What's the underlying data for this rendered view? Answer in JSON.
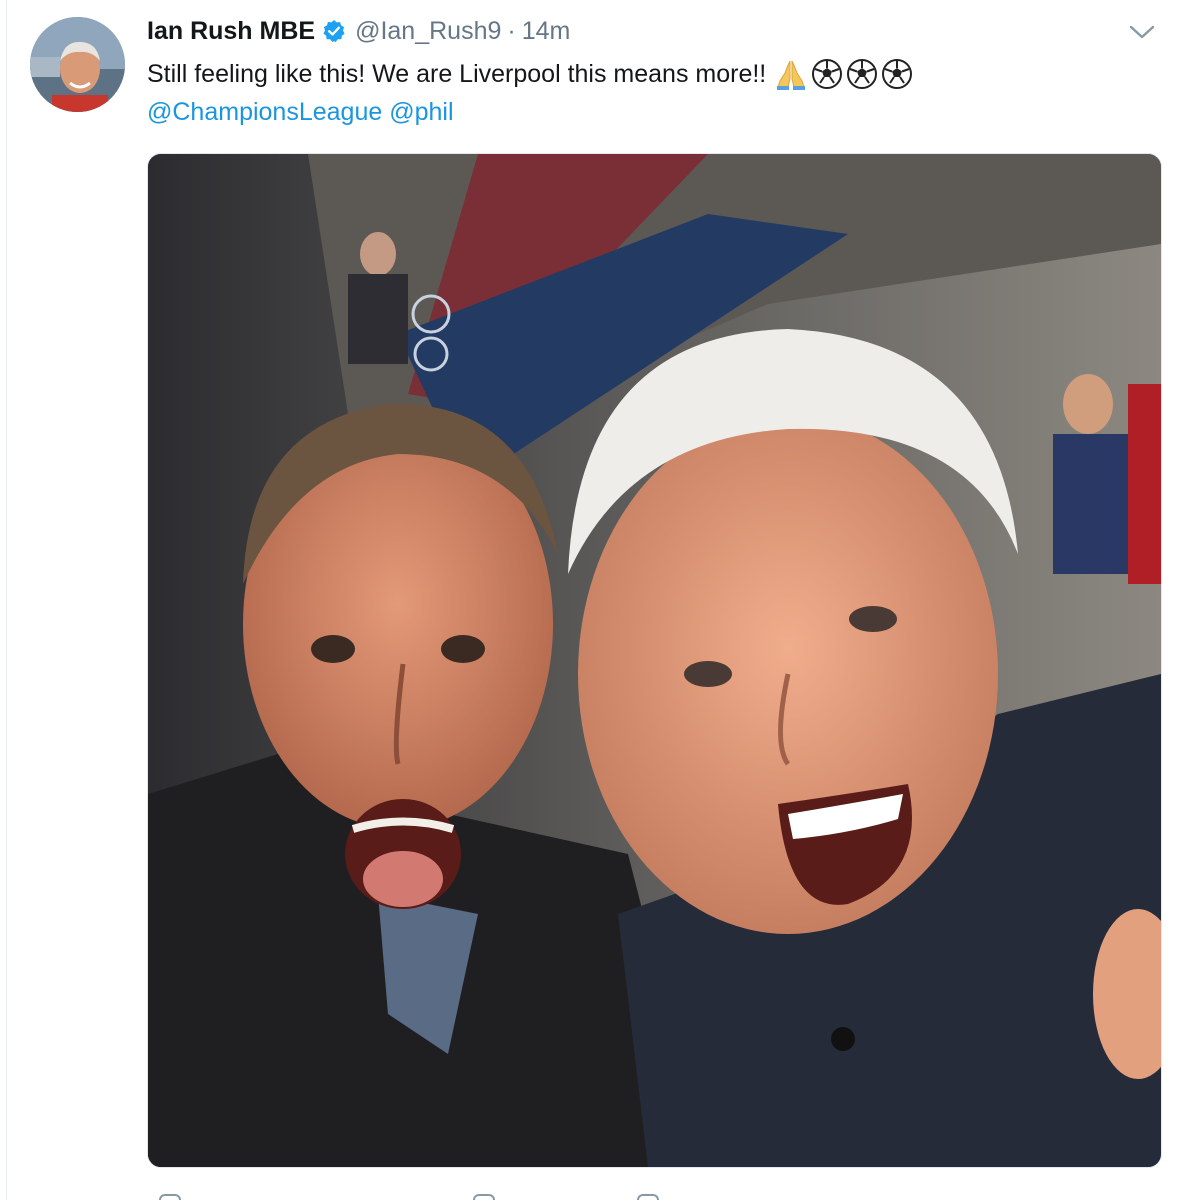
{
  "tweet": {
    "display_name": "Ian Rush MBE",
    "verified": true,
    "handle": "@Ian_Rush9",
    "separator": "·",
    "timestamp": "14m",
    "text": "Still feeling like this! We are Liverpool this means more!!",
    "emojis": [
      "praying-hands",
      "soccer-ball",
      "soccer-ball",
      "soccer-ball"
    ],
    "mentions": [
      "@ChampionsLeague",
      "@phil"
    ]
  },
  "colors": {
    "name": "#14171a",
    "secondary": "#657786",
    "link": "#1b95e0",
    "verified_badge": "#1da1f2",
    "border": "#e1e8ed"
  },
  "media": {
    "type": "photo",
    "subject": "two men celebrating selfie in stadium"
  }
}
